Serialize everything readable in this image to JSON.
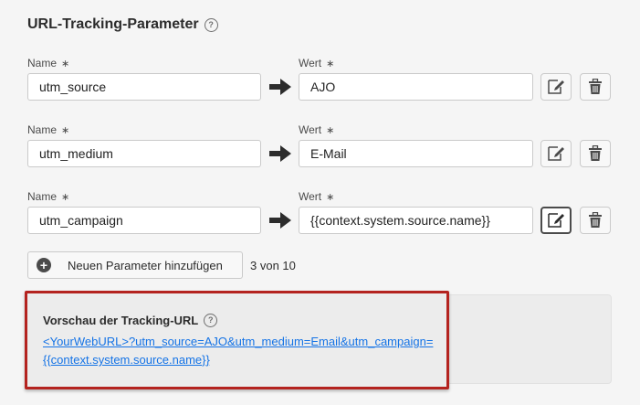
{
  "section": {
    "title": "URL-Tracking-Parameter",
    "help_icon": "?"
  },
  "labels": {
    "name": "Name",
    "value": "Wert",
    "required_mark": "∗"
  },
  "params": [
    {
      "name": "utm_source",
      "value": "AJO"
    },
    {
      "name": "utm_medium",
      "value": "E-Mail"
    },
    {
      "name": "utm_campaign",
      "value": "{{context.system.source.name}}"
    }
  ],
  "add_button": {
    "label": "Neuen Parameter hinzufügen"
  },
  "count_text": "3 von 10",
  "preview": {
    "title": "Vorschau der Tracking-URL",
    "url_line1": "<YourWebURL>?utm_source=AJO&utm_medium=Email&utm_campaign=",
    "url_line2": "{{context.system.source.name}}"
  },
  "icons": {
    "arrow": "arrow-right-icon",
    "edit": "edit-icon",
    "delete": "trash-icon",
    "add": "add-circle-icon",
    "help": "help-icon"
  },
  "colors": {
    "link": "#1473e6",
    "highlight_border": "#b4231f",
    "background": "#f5f5f5"
  }
}
